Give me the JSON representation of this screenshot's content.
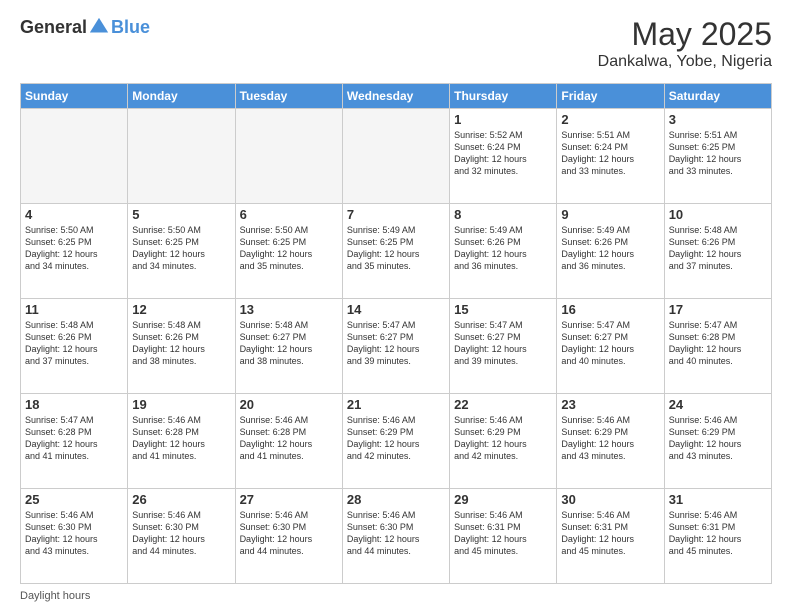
{
  "header": {
    "logo_general": "General",
    "logo_blue": "Blue",
    "month": "May 2025",
    "location": "Dankalwa, Yobe, Nigeria"
  },
  "days_of_week": [
    "Sunday",
    "Monday",
    "Tuesday",
    "Wednesday",
    "Thursday",
    "Friday",
    "Saturday"
  ],
  "footer": {
    "daylight_label": "Daylight hours"
  },
  "weeks": [
    {
      "days": [
        {
          "num": "",
          "empty": true
        },
        {
          "num": "",
          "empty": true
        },
        {
          "num": "",
          "empty": true
        },
        {
          "num": "",
          "empty": true
        },
        {
          "num": "1",
          "sunrise": "5:52 AM",
          "sunset": "6:24 PM",
          "daylight": "12 hours and 32 minutes."
        },
        {
          "num": "2",
          "sunrise": "5:51 AM",
          "sunset": "6:24 PM",
          "daylight": "12 hours and 33 minutes."
        },
        {
          "num": "3",
          "sunrise": "5:51 AM",
          "sunset": "6:25 PM",
          "daylight": "12 hours and 33 minutes."
        }
      ]
    },
    {
      "days": [
        {
          "num": "4",
          "sunrise": "5:50 AM",
          "sunset": "6:25 PM",
          "daylight": "12 hours and 34 minutes."
        },
        {
          "num": "5",
          "sunrise": "5:50 AM",
          "sunset": "6:25 PM",
          "daylight": "12 hours and 34 minutes."
        },
        {
          "num": "6",
          "sunrise": "5:50 AM",
          "sunset": "6:25 PM",
          "daylight": "12 hours and 35 minutes."
        },
        {
          "num": "7",
          "sunrise": "5:49 AM",
          "sunset": "6:25 PM",
          "daylight": "12 hours and 35 minutes."
        },
        {
          "num": "8",
          "sunrise": "5:49 AM",
          "sunset": "6:26 PM",
          "daylight": "12 hours and 36 minutes."
        },
        {
          "num": "9",
          "sunrise": "5:49 AM",
          "sunset": "6:26 PM",
          "daylight": "12 hours and 36 minutes."
        },
        {
          "num": "10",
          "sunrise": "5:48 AM",
          "sunset": "6:26 PM",
          "daylight": "12 hours and 37 minutes."
        }
      ]
    },
    {
      "days": [
        {
          "num": "11",
          "sunrise": "5:48 AM",
          "sunset": "6:26 PM",
          "daylight": "12 hours and 37 minutes."
        },
        {
          "num": "12",
          "sunrise": "5:48 AM",
          "sunset": "6:26 PM",
          "daylight": "12 hours and 38 minutes."
        },
        {
          "num": "13",
          "sunrise": "5:48 AM",
          "sunset": "6:27 PM",
          "daylight": "12 hours and 38 minutes."
        },
        {
          "num": "14",
          "sunrise": "5:47 AM",
          "sunset": "6:27 PM",
          "daylight": "12 hours and 39 minutes."
        },
        {
          "num": "15",
          "sunrise": "5:47 AM",
          "sunset": "6:27 PM",
          "daylight": "12 hours and 39 minutes."
        },
        {
          "num": "16",
          "sunrise": "5:47 AM",
          "sunset": "6:27 PM",
          "daylight": "12 hours and 40 minutes."
        },
        {
          "num": "17",
          "sunrise": "5:47 AM",
          "sunset": "6:28 PM",
          "daylight": "12 hours and 40 minutes."
        }
      ]
    },
    {
      "days": [
        {
          "num": "18",
          "sunrise": "5:47 AM",
          "sunset": "6:28 PM",
          "daylight": "12 hours and 41 minutes."
        },
        {
          "num": "19",
          "sunrise": "5:46 AM",
          "sunset": "6:28 PM",
          "daylight": "12 hours and 41 minutes."
        },
        {
          "num": "20",
          "sunrise": "5:46 AM",
          "sunset": "6:28 PM",
          "daylight": "12 hours and 41 minutes."
        },
        {
          "num": "21",
          "sunrise": "5:46 AM",
          "sunset": "6:29 PM",
          "daylight": "12 hours and 42 minutes."
        },
        {
          "num": "22",
          "sunrise": "5:46 AM",
          "sunset": "6:29 PM",
          "daylight": "12 hours and 42 minutes."
        },
        {
          "num": "23",
          "sunrise": "5:46 AM",
          "sunset": "6:29 PM",
          "daylight": "12 hours and 43 minutes."
        },
        {
          "num": "24",
          "sunrise": "5:46 AM",
          "sunset": "6:29 PM",
          "daylight": "12 hours and 43 minutes."
        }
      ]
    },
    {
      "days": [
        {
          "num": "25",
          "sunrise": "5:46 AM",
          "sunset": "6:30 PM",
          "daylight": "12 hours and 43 minutes."
        },
        {
          "num": "26",
          "sunrise": "5:46 AM",
          "sunset": "6:30 PM",
          "daylight": "12 hours and 44 minutes."
        },
        {
          "num": "27",
          "sunrise": "5:46 AM",
          "sunset": "6:30 PM",
          "daylight": "12 hours and 44 minutes."
        },
        {
          "num": "28",
          "sunrise": "5:46 AM",
          "sunset": "6:30 PM",
          "daylight": "12 hours and 44 minutes."
        },
        {
          "num": "29",
          "sunrise": "5:46 AM",
          "sunset": "6:31 PM",
          "daylight": "12 hours and 45 minutes."
        },
        {
          "num": "30",
          "sunrise": "5:46 AM",
          "sunset": "6:31 PM",
          "daylight": "12 hours and 45 minutes."
        },
        {
          "num": "31",
          "sunrise": "5:46 AM",
          "sunset": "6:31 PM",
          "daylight": "12 hours and 45 minutes."
        }
      ]
    }
  ]
}
